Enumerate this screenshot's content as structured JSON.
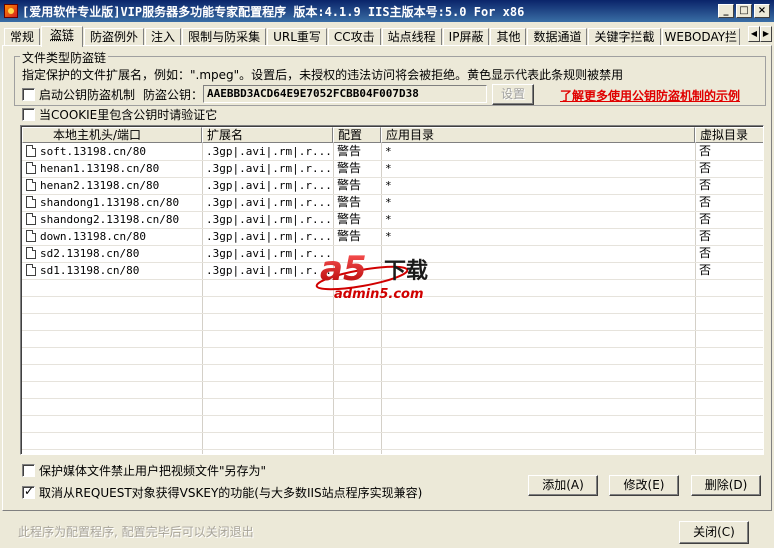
{
  "window": {
    "title": "[爱用软件专业版]VIP服务器多功能专家配置程序 版本:4.1.9 IIS主版本号:5.0 For x86",
    "min": "_",
    "max": "□",
    "close": "×"
  },
  "tabs": [
    "常规",
    "盗链",
    "防盗例外",
    "注入",
    "限制与防采集",
    "URL重写",
    "CC攻击",
    "站点线程",
    "IP屏蔽",
    "其他",
    "数据通道",
    "关键字拦截",
    "WEBODAY拦"
  ],
  "tab_scroll": {
    "left": "◀",
    "right": "▶"
  },
  "group": {
    "legend": "文件类型防盗链",
    "description": "指定保护的文件扩展名，例如：\".mpeg\"。设置后，未授权的违法访问将会被拒绝。黄色显示代表此条规则被禁用",
    "enable_label": "启动公钥防盗机制",
    "key_label": "防盗公钥：",
    "key_value": "AAEBBD3ACD64E9E7052FCBB04F007D38",
    "set_button": "设置",
    "link_text": "了解更多使用公钥防盗机制的示例",
    "cookie_label": "当COOKIE里包含公钥时请验证它"
  },
  "table": {
    "columns": [
      "本地主机头/端口",
      "扩展名",
      "配置",
      "应用目录",
      "虚拟目录"
    ],
    "rows": [
      {
        "host": "soft.13198.cn/80",
        "ext": ".3gp|.avi|.rm|.r...",
        "cfg": "警告",
        "dir": "*",
        "vdir": "否"
      },
      {
        "host": "henan1.13198.cn/80",
        "ext": ".3gp|.avi|.rm|.r...",
        "cfg": "警告",
        "dir": "*",
        "vdir": "否"
      },
      {
        "host": "henan2.13198.cn/80",
        "ext": ".3gp|.avi|.rm|.r...",
        "cfg": "警告",
        "dir": "*",
        "vdir": "否"
      },
      {
        "host": "shandong1.13198.cn/80",
        "ext": ".3gp|.avi|.rm|.r...",
        "cfg": "警告",
        "dir": "*",
        "vdir": "否"
      },
      {
        "host": "shandong2.13198.cn/80",
        "ext": ".3gp|.avi|.rm|.r...",
        "cfg": "警告",
        "dir": "*",
        "vdir": "否"
      },
      {
        "host": "down.13198.cn/80",
        "ext": ".3gp|.avi|.rm|.r...",
        "cfg": "警告",
        "dir": "*",
        "vdir": "否"
      },
      {
        "host": "sd2.13198.cn/80",
        "ext": ".3gp|.avi|.rm|.r...",
        "cfg": "",
        "dir": "",
        "vdir": "否"
      },
      {
        "host": "sd1.13198.cn/80",
        "ext": ".3gp|.avi|.rm|.r...",
        "cfg": "",
        "dir": "",
        "vdir": "否"
      }
    ]
  },
  "watermark": {
    "logo": "a5",
    "logo_suffix": "下载",
    "site": "admin5.com"
  },
  "options": {
    "protect_media_label": "保护媒体文件禁止用户把视频文件\"另存为\"",
    "cancel_vskey_label": "取消从REQUEST对象获得VSKEY的功能(与大多数IIS站点程序实现兼容)"
  },
  "buttons": {
    "add": "添加(A)",
    "edit": "修改(E)",
    "delete": "删除(D)",
    "close": "关闭(C)"
  },
  "status": "此程序为配置程序, 配置完毕后可以关闭退出",
  "colors": {
    "link": "#e00000",
    "titlebar": "#0a246a",
    "face": "#ece9d8"
  }
}
